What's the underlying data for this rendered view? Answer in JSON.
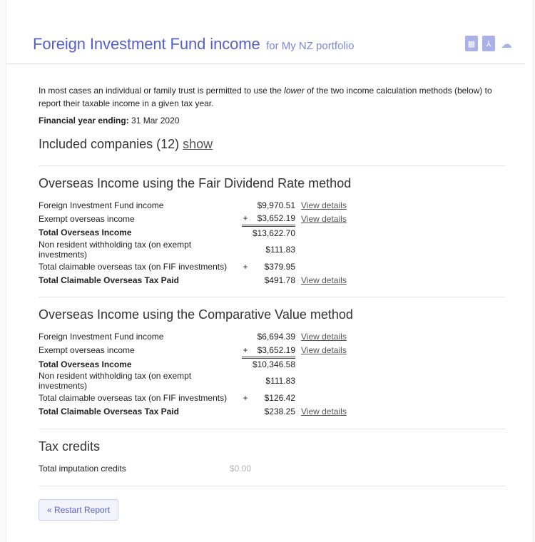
{
  "header": {
    "title": "Foreign Investment Fund income",
    "subtitle": "for My NZ portfolio",
    "icons": [
      "spreadsheet-icon",
      "pdf-icon",
      "cloud-icon"
    ],
    "accent": "#5561c9"
  },
  "intro": {
    "before": "In most cases an individual or family trust is permitted to use the ",
    "emphasis": "lower",
    "after": " of the two income calculation methods (below) to report their taxable income in a given tax year."
  },
  "financial_year": {
    "label": "Financial year ending:",
    "value": "31 Mar 2020"
  },
  "included": {
    "text": "Included companies (12)",
    "link": "show"
  },
  "fdr": {
    "title": "Overseas Income using the Fair Dividend Rate method",
    "rows": [
      {
        "label": "Foreign Investment Fund income",
        "plus": "",
        "amount": "$9,970.51",
        "link": "View details"
      },
      {
        "label": "Exempt overseas income",
        "plus": "+",
        "amount": "$3,652.19",
        "link": "View details"
      },
      {
        "label": "Total Overseas Income",
        "plus": "",
        "amount": "$13,622.70",
        "link": ""
      },
      {
        "label": "Non resident withholding tax (on exempt investments)",
        "plus": "",
        "amount": "$111.83",
        "link": ""
      },
      {
        "label": "Total claimable overseas tax (on FIF investments)",
        "plus": "+",
        "amount": "$379.95",
        "link": ""
      },
      {
        "label": "Total Claimable Overseas Tax Paid",
        "plus": "",
        "amount": "$491.78",
        "link": "View details"
      }
    ]
  },
  "cv": {
    "title": "Overseas Income using the Comparative Value method",
    "rows": [
      {
        "label": "Foreign Investment Fund income",
        "plus": "",
        "amount": "$6,694.39",
        "link": "View details"
      },
      {
        "label": "Exempt overseas income",
        "plus": "+",
        "amount": "$3,652.19",
        "link": "View details"
      },
      {
        "label": "Total Overseas Income",
        "plus": "",
        "amount": "$10,346.58",
        "link": ""
      },
      {
        "label": "Non resident withholding tax (on exempt investments)",
        "plus": "",
        "amount": "$111.83",
        "link": ""
      },
      {
        "label": "Total claimable overseas tax (on FIF investments)",
        "plus": "+",
        "amount": "$126.42",
        "link": ""
      },
      {
        "label": "Total Claimable Overseas Tax Paid",
        "plus": "",
        "amount": "$238.25",
        "link": "View details"
      }
    ]
  },
  "tax_credits": {
    "title": "Tax credits",
    "label": "Total imputation credits",
    "amount": "$0.00"
  },
  "restart_button": "« Restart Report"
}
